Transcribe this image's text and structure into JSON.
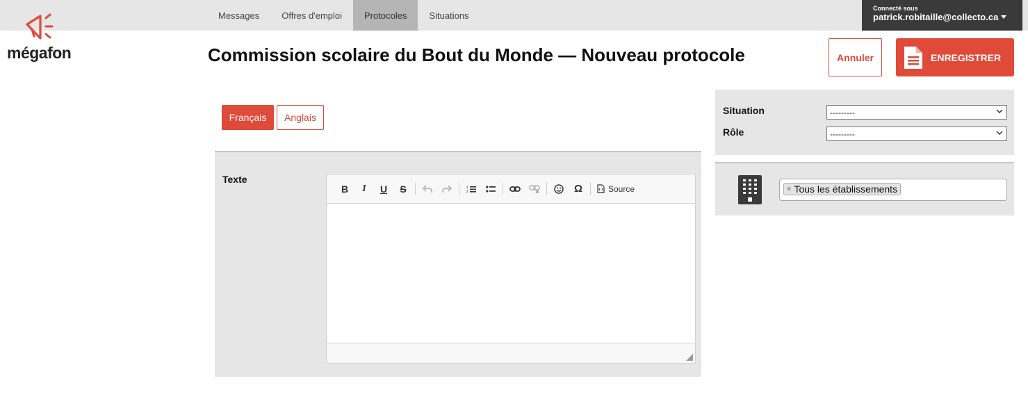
{
  "nav": {
    "items": [
      {
        "label": "Messages"
      },
      {
        "label": "Offres d'emploi"
      },
      {
        "label": "Protocoles"
      },
      {
        "label": "Situations"
      }
    ],
    "active": "Protocoles"
  },
  "user": {
    "connected_label": "Connecté sous",
    "email": "patrick.robitaille@collecto.ca"
  },
  "logo": {
    "text": "mégafon",
    "icon": "megaphone-icon"
  },
  "header": {
    "title": "Commission scolaire du Bout du Monde — Nouveau protocole"
  },
  "actions": {
    "cancel_label": "Annuler",
    "save_label": "ENREGISTRER"
  },
  "languages": [
    {
      "label": "Français",
      "active": true
    },
    {
      "label": "Anglais",
      "active": false
    }
  ],
  "editor": {
    "label": "Texte",
    "source_label": "Source",
    "toolbar_icons": [
      "bold-icon",
      "italic-icon",
      "underline-icon",
      "strikethrough-icon",
      "undo-icon",
      "redo-icon",
      "numbered-list-icon",
      "bulleted-list-icon",
      "link-icon",
      "unlink-icon",
      "smiley-icon",
      "omega-icon",
      "source-icon"
    ],
    "content": ""
  },
  "filters": {
    "situation_label": "Situation",
    "situation_value": "---------",
    "role_label": "Rôle",
    "role_value": "---------"
  },
  "establishments": {
    "icon": "building-icon",
    "tags": [
      {
        "label": "Tous les établissements",
        "remove": "×"
      }
    ]
  },
  "colors": {
    "accent": "#e04a38",
    "topbar": "#e6e6e6",
    "user_bg": "#3a3a3a",
    "panel": "#e6e6e6"
  }
}
